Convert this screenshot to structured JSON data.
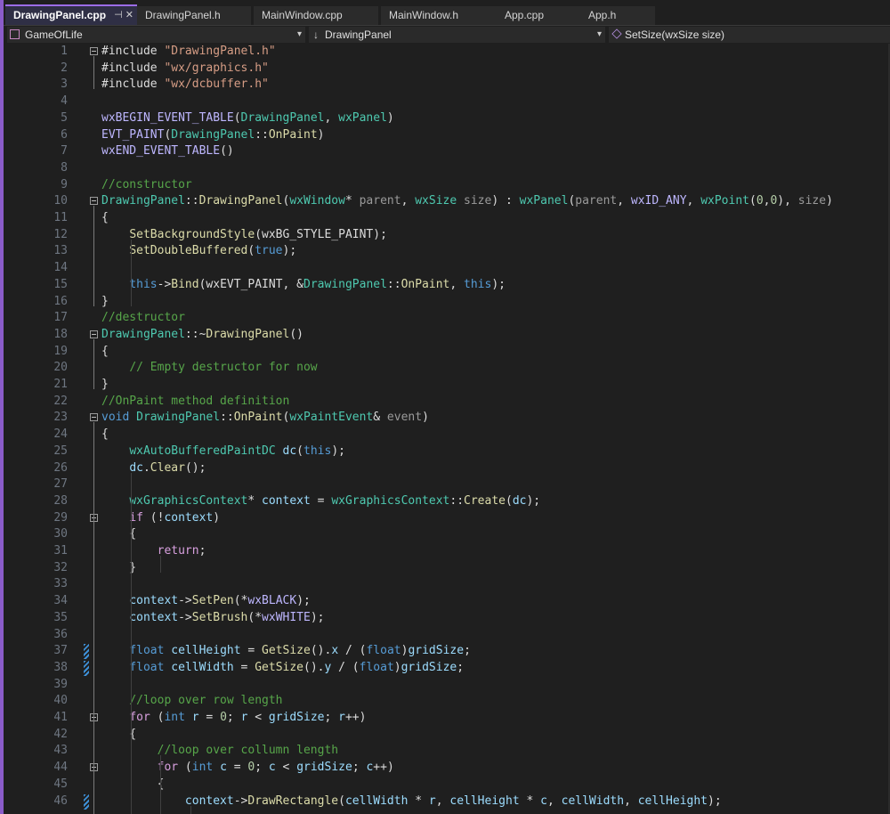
{
  "tabs": [
    {
      "label": "DrawingPanel.cpp",
      "active": true,
      "icons": "⊣ ✕"
    },
    {
      "label": "DrawingPanel.h"
    },
    {
      "label": "MainWindow.cpp"
    },
    {
      "label": "MainWindow.h"
    },
    {
      "label": "App.cpp"
    },
    {
      "label": "App.h"
    }
  ],
  "navigation": {
    "project": "GameOfLife",
    "class_scope": "DrawingPanel",
    "member": "SetSize(wxSize size)"
  },
  "colors": {
    "keyword": "#569cd6",
    "type": "#4ec9b0",
    "func": "#dcdcaa",
    "string": "#d69d85",
    "comment": "#57a64a",
    "macro": "#beb7ff",
    "plain": "#dcdcdc",
    "param": "#9cdcfe",
    "ctl": "#d8a0df",
    "number": "#b5cea8",
    "accent": "#8a5cc9"
  },
  "lines": [
    {
      "n": "1",
      "t": [
        [
          "p",
          "#include "
        ],
        [
          "s",
          "\"DrawingPanel.h\""
        ]
      ]
    },
    {
      "n": "2",
      "t": [
        [
          "p",
          "#include "
        ],
        [
          "s",
          "\"wx/graphics.h\""
        ]
      ]
    },
    {
      "n": "3",
      "t": [
        [
          "p",
          "#include "
        ],
        [
          "s",
          "\"wx/dcbuffer.h\""
        ]
      ]
    },
    {
      "n": "4",
      "t": []
    },
    {
      "n": "5",
      "t": [
        [
          "m",
          "wxBEGIN_EVENT_TABLE"
        ],
        [
          "p",
          "("
        ],
        [
          "y",
          "DrawingPanel"
        ],
        [
          "p",
          ", "
        ],
        [
          "y",
          "wxPanel"
        ],
        [
          "p",
          ")"
        ]
      ]
    },
    {
      "n": "6",
      "t": [
        [
          "m",
          "EVT_PAINT"
        ],
        [
          "p",
          "("
        ],
        [
          "y",
          "DrawingPanel"
        ],
        [
          "p",
          "::"
        ],
        [
          "f",
          "OnPaint"
        ],
        [
          "p",
          ")"
        ]
      ]
    },
    {
      "n": "7",
      "t": [
        [
          "m",
          "wxEND_EVENT_TABLE"
        ],
        [
          "p",
          "()"
        ]
      ]
    },
    {
      "n": "8",
      "t": []
    },
    {
      "n": "9",
      "t": [
        [
          "c",
          "//constructor"
        ]
      ]
    },
    {
      "n": "10",
      "t": [
        [
          "y",
          "DrawingPanel"
        ],
        [
          "p",
          "::"
        ],
        [
          "f",
          "DrawingPanel"
        ],
        [
          "p",
          "("
        ],
        [
          "y",
          "wxWindow"
        ],
        [
          "p",
          "* "
        ],
        [
          "a",
          "parent"
        ],
        [
          "p",
          ", "
        ],
        [
          "y",
          "wxSize"
        ],
        [
          "p",
          " "
        ],
        [
          "a",
          "size"
        ],
        [
          "p",
          ") : "
        ],
        [
          "y",
          "wxPanel"
        ],
        [
          "p",
          "("
        ],
        [
          "a",
          "parent"
        ],
        [
          "p",
          ", "
        ],
        [
          "m",
          "wxID_ANY"
        ],
        [
          "p",
          ", "
        ],
        [
          "y",
          "wxPoint"
        ],
        [
          "p",
          "("
        ],
        [
          "n",
          "0"
        ],
        [
          "p",
          ","
        ],
        [
          "n",
          "0"
        ],
        [
          "p",
          "), "
        ],
        [
          "a",
          "size"
        ],
        [
          "p",
          ")"
        ]
      ]
    },
    {
      "n": "11",
      "t": [
        [
          "p",
          "{"
        ]
      ]
    },
    {
      "n": "12",
      "t": [
        [
          "p",
          "    "
        ],
        [
          "f",
          "SetBackgroundStyle"
        ],
        [
          "p",
          "(wxBG_STYLE_PAINT);"
        ]
      ]
    },
    {
      "n": "13",
      "t": [
        [
          "p",
          "    "
        ],
        [
          "f",
          "SetDoubleBuffered"
        ],
        [
          "p",
          "("
        ],
        [
          "k",
          "true"
        ],
        [
          "p",
          ");"
        ]
      ]
    },
    {
      "n": "14",
      "t": []
    },
    {
      "n": "15",
      "t": [
        [
          "p",
          "    "
        ],
        [
          "k",
          "this"
        ],
        [
          "p",
          "->"
        ],
        [
          "f",
          "Bind"
        ],
        [
          "p",
          "(wxEVT_PAINT, &"
        ],
        [
          "y",
          "DrawingPanel"
        ],
        [
          "p",
          "::"
        ],
        [
          "f",
          "OnPaint"
        ],
        [
          "p",
          ", "
        ],
        [
          "k",
          "this"
        ],
        [
          "p",
          ");"
        ]
      ]
    },
    {
      "n": "16",
      "t": [
        [
          "p",
          "}"
        ]
      ]
    },
    {
      "n": "17",
      "t": [
        [
          "c",
          "//destructor"
        ]
      ]
    },
    {
      "n": "18",
      "t": [
        [
          "y",
          "DrawingPanel"
        ],
        [
          "p",
          "::~"
        ],
        [
          "f",
          "DrawingPanel"
        ],
        [
          "p",
          "()"
        ]
      ]
    },
    {
      "n": "19",
      "t": [
        [
          "p",
          "{"
        ]
      ]
    },
    {
      "n": "20",
      "t": [
        [
          "p",
          "    "
        ],
        [
          "c",
          "// Empty destructor for now"
        ]
      ]
    },
    {
      "n": "21",
      "t": [
        [
          "p",
          "}"
        ]
      ]
    },
    {
      "n": "22",
      "t": [
        [
          "c",
          "//OnPaint method definition"
        ]
      ]
    },
    {
      "n": "23",
      "t": [
        [
          "k",
          "void"
        ],
        [
          "p",
          " "
        ],
        [
          "y",
          "DrawingPanel"
        ],
        [
          "p",
          "::"
        ],
        [
          "f",
          "OnPaint"
        ],
        [
          "p",
          "("
        ],
        [
          "y",
          "wxPaintEvent"
        ],
        [
          "p",
          "& "
        ],
        [
          "a",
          "event"
        ],
        [
          "p",
          ")"
        ]
      ]
    },
    {
      "n": "24",
      "t": [
        [
          "p",
          "{"
        ]
      ]
    },
    {
      "n": "25",
      "t": [
        [
          "p",
          "    "
        ],
        [
          "y",
          "wxAutoBufferedPaintDC"
        ],
        [
          "p",
          " "
        ],
        [
          "v",
          "dc"
        ],
        [
          "p",
          "("
        ],
        [
          "k",
          "this"
        ],
        [
          "p",
          ");"
        ]
      ]
    },
    {
      "n": "26",
      "t": [
        [
          "p",
          "    "
        ],
        [
          "v",
          "dc"
        ],
        [
          "p",
          "."
        ],
        [
          "f",
          "Clear"
        ],
        [
          "p",
          "();"
        ]
      ]
    },
    {
      "n": "27",
      "t": []
    },
    {
      "n": "28",
      "t": [
        [
          "p",
          "    "
        ],
        [
          "y",
          "wxGraphicsContext"
        ],
        [
          "p",
          "* "
        ],
        [
          "v",
          "context"
        ],
        [
          "p",
          " = "
        ],
        [
          "y",
          "wxGraphicsContext"
        ],
        [
          "p",
          "::"
        ],
        [
          "f",
          "Create"
        ],
        [
          "p",
          "("
        ],
        [
          "v",
          "dc"
        ],
        [
          "p",
          ");"
        ]
      ]
    },
    {
      "n": "29",
      "t": [
        [
          "p",
          "    "
        ],
        [
          "x",
          "if"
        ],
        [
          "p",
          " (!"
        ],
        [
          "v",
          "context"
        ],
        [
          "p",
          ")"
        ]
      ]
    },
    {
      "n": "30",
      "t": [
        [
          "p",
          "    {"
        ]
      ]
    },
    {
      "n": "31",
      "t": [
        [
          "p",
          "        "
        ],
        [
          "x",
          "return"
        ],
        [
          "p",
          ";"
        ]
      ]
    },
    {
      "n": "32",
      "t": [
        [
          "p",
          "    }"
        ]
      ]
    },
    {
      "n": "33",
      "t": []
    },
    {
      "n": "34",
      "t": [
        [
          "p",
          "    "
        ],
        [
          "v",
          "context"
        ],
        [
          "p",
          "->"
        ],
        [
          "f",
          "SetPen"
        ],
        [
          "p",
          "(*"
        ],
        [
          "m",
          "wxBLACK"
        ],
        [
          "p",
          ");"
        ]
      ]
    },
    {
      "n": "35",
      "t": [
        [
          "p",
          "    "
        ],
        [
          "v",
          "context"
        ],
        [
          "p",
          "->"
        ],
        [
          "f",
          "SetBrush"
        ],
        [
          "p",
          "(*"
        ],
        [
          "m",
          "wxWHITE"
        ],
        [
          "p",
          ");"
        ]
      ]
    },
    {
      "n": "36",
      "t": []
    },
    {
      "n": "37",
      "t": [
        [
          "p",
          "    "
        ],
        [
          "k",
          "float"
        ],
        [
          "p",
          " "
        ],
        [
          "v",
          "cellHeight"
        ],
        [
          "p",
          " = "
        ],
        [
          "f",
          "GetSize"
        ],
        [
          "p",
          "()."
        ],
        [
          "v",
          "x"
        ],
        [
          "p",
          " / ("
        ],
        [
          "k",
          "float"
        ],
        [
          "p",
          ")"
        ],
        [
          "v",
          "gridSize"
        ],
        [
          "p",
          ";"
        ]
      ]
    },
    {
      "n": "38",
      "t": [
        [
          "p",
          "    "
        ],
        [
          "k",
          "float"
        ],
        [
          "p",
          " "
        ],
        [
          "v",
          "cellWidth"
        ],
        [
          "p",
          " = "
        ],
        [
          "f",
          "GetSize"
        ],
        [
          "p",
          "()."
        ],
        [
          "v",
          "y"
        ],
        [
          "p",
          " / ("
        ],
        [
          "k",
          "float"
        ],
        [
          "p",
          ")"
        ],
        [
          "v",
          "gridSize"
        ],
        [
          "p",
          ";"
        ]
      ]
    },
    {
      "n": "39",
      "t": []
    },
    {
      "n": "40",
      "t": [
        [
          "p",
          "    "
        ],
        [
          "c",
          "//loop over row length"
        ]
      ]
    },
    {
      "n": "41",
      "t": [
        [
          "p",
          "    "
        ],
        [
          "x",
          "for"
        ],
        [
          "p",
          " ("
        ],
        [
          "k",
          "int"
        ],
        [
          "p",
          " "
        ],
        [
          "v",
          "r"
        ],
        [
          "p",
          " = "
        ],
        [
          "n",
          "0"
        ],
        [
          "p",
          "; "
        ],
        [
          "v",
          "r"
        ],
        [
          "p",
          " < "
        ],
        [
          "v",
          "gridSize"
        ],
        [
          "p",
          "; "
        ],
        [
          "v",
          "r"
        ],
        [
          "p",
          "++)"
        ]
      ]
    },
    {
      "n": "42",
      "t": [
        [
          "p",
          "    {"
        ]
      ]
    },
    {
      "n": "43",
      "t": [
        [
          "p",
          "        "
        ],
        [
          "c",
          "//loop over collumn length"
        ]
      ]
    },
    {
      "n": "44",
      "t": [
        [
          "p",
          "        "
        ],
        [
          "x",
          "for"
        ],
        [
          "p",
          " ("
        ],
        [
          "k",
          "int"
        ],
        [
          "p",
          " "
        ],
        [
          "v",
          "c"
        ],
        [
          "p",
          " = "
        ],
        [
          "n",
          "0"
        ],
        [
          "p",
          "; "
        ],
        [
          "v",
          "c"
        ],
        [
          "p",
          " < "
        ],
        [
          "v",
          "gridSize"
        ],
        [
          "p",
          "; "
        ],
        [
          "v",
          "c"
        ],
        [
          "p",
          "++)"
        ]
      ]
    },
    {
      "n": "45",
      "t": [
        [
          "p",
          "        {"
        ]
      ]
    },
    {
      "n": "46",
      "t": [
        [
          "p",
          "            "
        ],
        [
          "v",
          "context"
        ],
        [
          "p",
          "->"
        ],
        [
          "f",
          "DrawRectangle"
        ],
        [
          "p",
          "("
        ],
        [
          "v",
          "cellWidth"
        ],
        [
          "p",
          " * "
        ],
        [
          "v",
          "r"
        ],
        [
          "p",
          ", "
        ],
        [
          "v",
          "cellHeight"
        ],
        [
          "p",
          " * "
        ],
        [
          "v",
          "c"
        ],
        [
          "p",
          ", "
        ],
        [
          "v",
          "cellWidth"
        ],
        [
          "p",
          ", "
        ],
        [
          "v",
          "cellHeight"
        ],
        [
          "p",
          ");"
        ]
      ]
    }
  ],
  "fold_markers": [
    "1",
    "10",
    "18",
    "23",
    "29",
    "41",
    "44"
  ],
  "change_markers": [
    "37",
    "38",
    "46"
  ]
}
